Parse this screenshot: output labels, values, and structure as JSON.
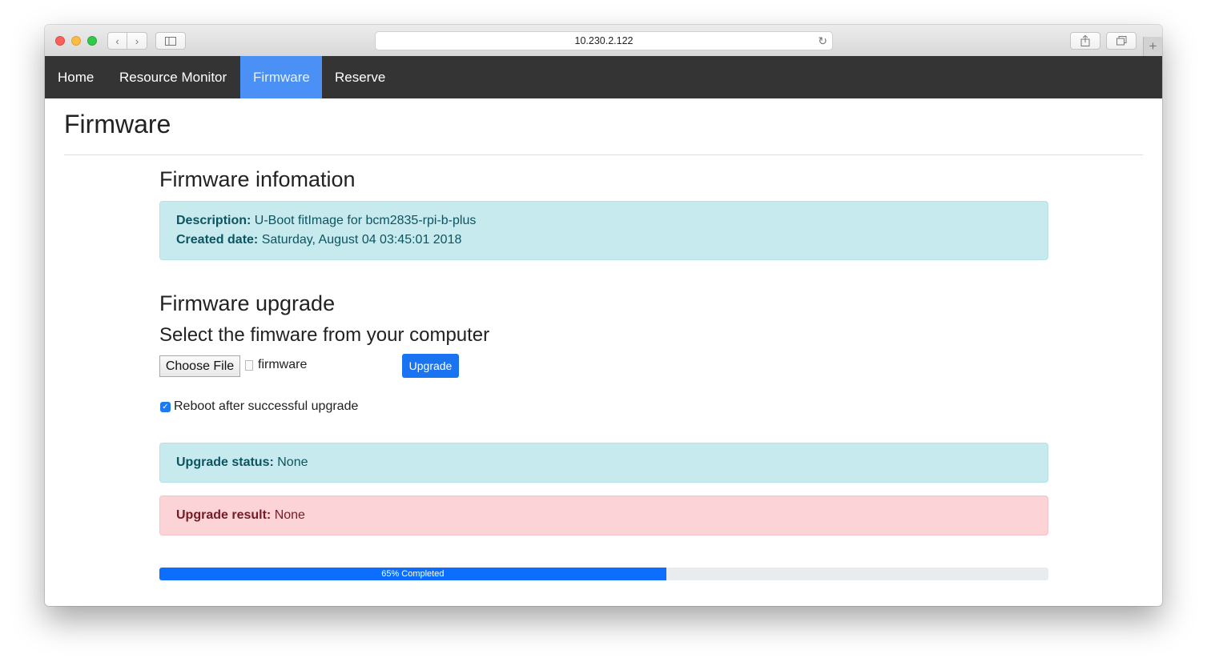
{
  "browser": {
    "url": "10.230.2.122"
  },
  "nav": {
    "items": [
      {
        "label": "Home"
      },
      {
        "label": "Resource Monitor"
      },
      {
        "label": "Firmware"
      },
      {
        "label": "Reserve"
      }
    ],
    "active": "Firmware"
  },
  "page": {
    "title": "Firmware"
  },
  "firmware_info": {
    "heading": "Firmware infomation",
    "description_label": "Description:",
    "description_value": " U-Boot fitImage for bcm2835-rpi-b-plus",
    "created_label": "Created date:",
    "created_value": " Saturday, August 04 03:45:01 2018"
  },
  "upgrade": {
    "heading": "Firmware upgrade",
    "subheading": "Select the fimware from your computer",
    "choose_file_label": "Choose File",
    "file_name": "firmware",
    "upgrade_button": "Upgrade",
    "reboot_label": "Reboot after successful upgrade",
    "reboot_checked": true,
    "status_label": "Upgrade status:",
    "status_value": " None",
    "result_label": "Upgrade result:",
    "result_value": " None",
    "progress_percent": 57,
    "progress_text": "65% Completed"
  },
  "colors": {
    "navbar": "#343434",
    "active_tab": "#4a90f5",
    "info_bg": "#c7eaef",
    "danger_bg": "#fcd3d7",
    "primary": "#1a73f0"
  }
}
